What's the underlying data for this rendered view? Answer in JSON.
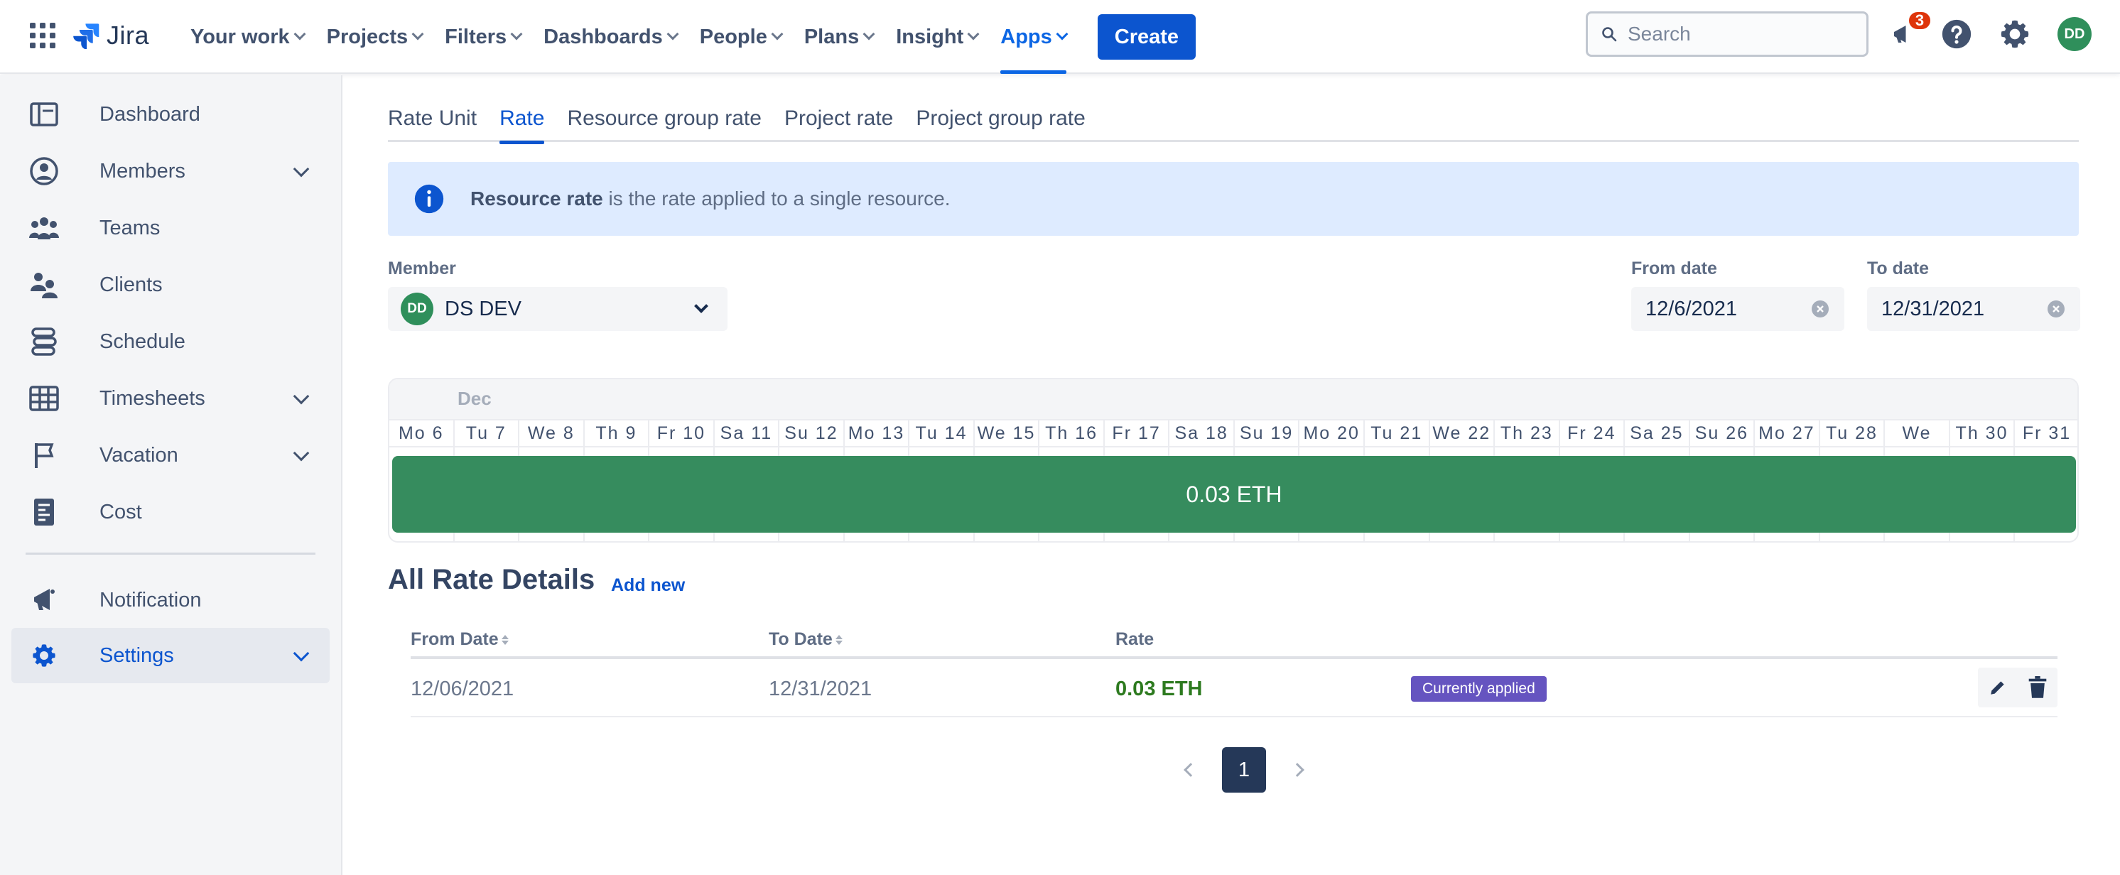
{
  "topnav": {
    "logo_text": "Jira",
    "items": [
      {
        "label": "Your work"
      },
      {
        "label": "Projects"
      },
      {
        "label": "Filters"
      },
      {
        "label": "Dashboards"
      },
      {
        "label": "People"
      },
      {
        "label": "Plans"
      },
      {
        "label": "Insight"
      },
      {
        "label": "Apps",
        "active": true
      }
    ],
    "create_label": "Create",
    "search_placeholder": "Search",
    "notification_count": "3",
    "user_initials": "DD"
  },
  "sidebar": {
    "items": [
      {
        "label": "Dashboard",
        "icon": "dashboard-icon"
      },
      {
        "label": "Members",
        "icon": "members-icon",
        "expandable": true
      },
      {
        "label": "Teams",
        "icon": "teams-icon"
      },
      {
        "label": "Clients",
        "icon": "clients-icon"
      },
      {
        "label": "Schedule",
        "icon": "schedule-icon"
      },
      {
        "label": "Timesheets",
        "icon": "timesheets-icon",
        "expandable": true
      },
      {
        "label": "Vacation",
        "icon": "flag-icon",
        "expandable": true
      },
      {
        "label": "Cost",
        "icon": "cost-icon"
      },
      {
        "label": "Notification",
        "icon": "megaphone-icon"
      },
      {
        "label": "Settings",
        "icon": "gear-icon",
        "expandable": true,
        "active": true
      }
    ]
  },
  "tabs": [
    {
      "label": "Rate Unit"
    },
    {
      "label": "Rate",
      "active": true
    },
    {
      "label": "Resource group rate"
    },
    {
      "label": "Project rate"
    },
    {
      "label": "Project group rate"
    }
  ],
  "info": {
    "bold": "Resource rate",
    "text": " is the rate applied to a single resource."
  },
  "filters": {
    "member_label": "Member",
    "member_initials": "DD",
    "member_name": "DS DEV",
    "from_label": "From date",
    "from_value": "12/6/2021",
    "to_label": "To date",
    "to_value": "12/31/2021"
  },
  "timeline": {
    "month": "Dec",
    "days": [
      "Mo 6",
      "Tu 7",
      "We 8",
      "Th 9",
      "Fr 10",
      "Sa 11",
      "Su 12",
      "Mo 13",
      "Tu 14",
      "We 15",
      "Th 16",
      "Fr 17",
      "Sa 18",
      "Su 19",
      "Mo 20",
      "Tu 21",
      "We 22",
      "Th 23",
      "Fr 24",
      "Sa 25",
      "Su 26",
      "Mo 27",
      "Tu 28",
      "We",
      "Th 30",
      "Fr 31"
    ],
    "bar_label": "0.03 ETH"
  },
  "details": {
    "title": "All Rate Details",
    "add_new": "Add new",
    "columns": {
      "from": "From Date",
      "to": "To Date",
      "rate": "Rate"
    },
    "rows": [
      {
        "from": "12/06/2021",
        "to": "12/31/2021",
        "rate": "0.03 ETH",
        "status": "Currently applied"
      }
    ]
  },
  "pagination": {
    "current": "1"
  },
  "colors": {
    "brand": "#0c55cf",
    "timeline_bar": "#368c5e",
    "status_badge": "#6554c0",
    "rate_text": "#2d7a1f"
  }
}
